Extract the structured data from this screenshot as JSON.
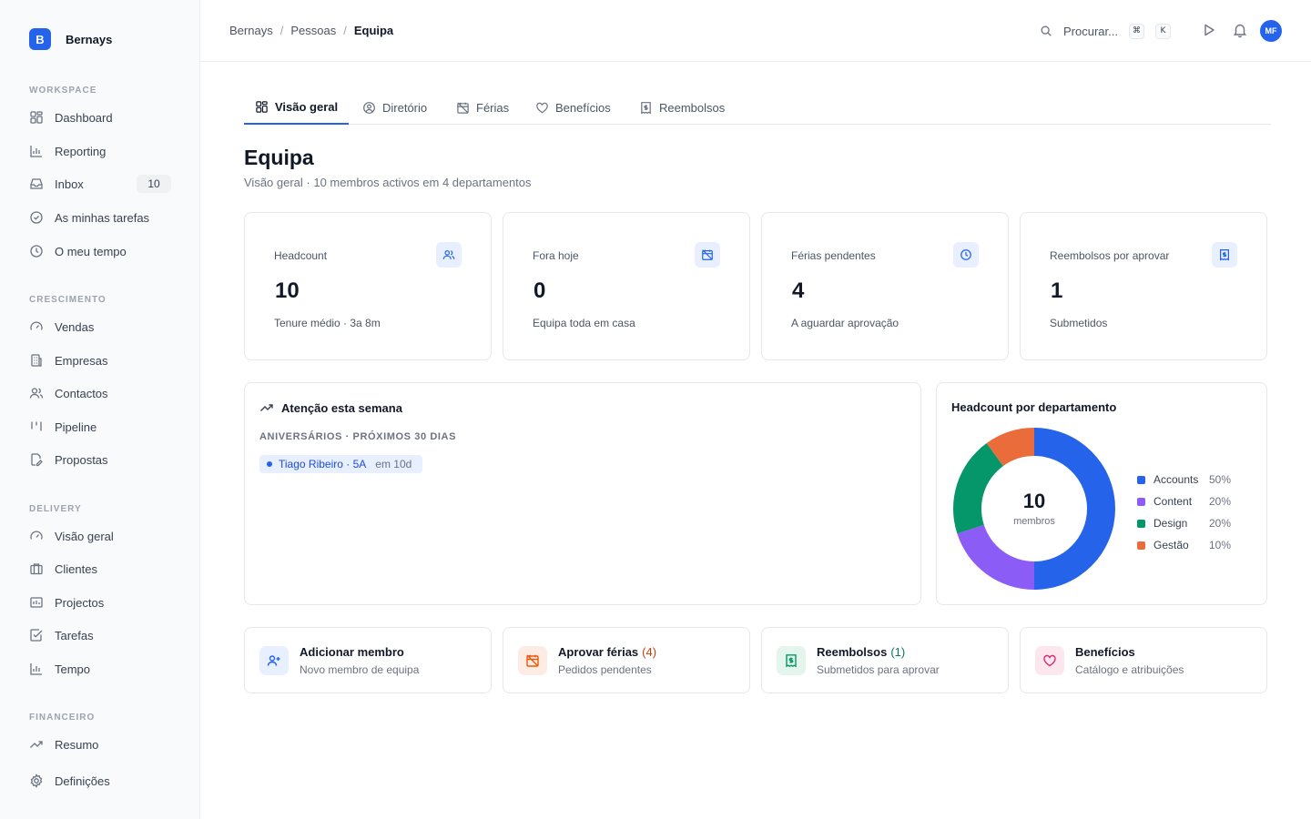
{
  "brand": {
    "initial": "B",
    "name": "Bernays"
  },
  "sidebar": {
    "sections": [
      {
        "label": "WORKSPACE",
        "items": [
          {
            "label": "Dashboard",
            "icon": "grid-icon"
          },
          {
            "label": "Reporting",
            "icon": "bar-chart-icon"
          },
          {
            "label": "Inbox",
            "icon": "inbox-icon",
            "badge": "10"
          },
          {
            "label": "As minhas tarefas",
            "icon": "check-circle-icon"
          },
          {
            "label": "O meu tempo",
            "icon": "clock-icon"
          }
        ]
      },
      {
        "label": "CRESCIMENTO",
        "items": [
          {
            "label": "Vendas",
            "icon": "gauge-icon"
          },
          {
            "label": "Empresas",
            "icon": "building-icon"
          },
          {
            "label": "Contactos",
            "icon": "users-icon"
          },
          {
            "label": "Pipeline",
            "icon": "pipeline-icon"
          },
          {
            "label": "Propostas",
            "icon": "document-edit-icon"
          }
        ]
      },
      {
        "label": "DELIVERY",
        "items": [
          {
            "label": "Visão geral",
            "icon": "gauge-icon"
          },
          {
            "label": "Clientes",
            "icon": "briefcase-icon"
          },
          {
            "label": "Projectos",
            "icon": "folder-icon"
          },
          {
            "label": "Tarefas",
            "icon": "checkbox-icon"
          },
          {
            "label": "Tempo",
            "icon": "bar-chart-icon"
          }
        ]
      },
      {
        "label": "FINANCEIRO",
        "items": [
          {
            "label": "Resumo",
            "icon": "trend-icon"
          },
          {
            "label": "Definições",
            "icon": "gear-icon"
          }
        ]
      }
    ]
  },
  "header": {
    "breadcrumb": [
      "Bernays",
      "Pessoas",
      "Equipa"
    ],
    "search_label": "Procurar...",
    "shortcut": [
      "⌘",
      "K"
    ],
    "avatar_initials": "MF"
  },
  "tabs": [
    {
      "label": "Visão geral",
      "icon": "grid-icon",
      "active": true
    },
    {
      "label": "Diretório",
      "icon": "user-circle-icon"
    },
    {
      "label": "Férias",
      "icon": "calendar-off-icon"
    },
    {
      "label": "Benefícios",
      "icon": "heart-icon"
    },
    {
      "label": "Reembolsos",
      "icon": "receipt-icon"
    }
  ],
  "page": {
    "title": "Equipa",
    "subtitle": "Visão geral · 10 membros activos em 4 departamentos"
  },
  "stats": [
    {
      "label": "Headcount",
      "value": "10",
      "desc": "Tenure médio · 3a 8m",
      "icon": "users-icon"
    },
    {
      "label": "Fora hoje",
      "value": "0",
      "desc": "Equipa toda em casa",
      "icon": "calendar-off-icon"
    },
    {
      "label": "Férias pendentes",
      "value": "4",
      "desc": "A aguardar aprovação",
      "icon": "clock-icon"
    },
    {
      "label": "Reembolsos por aprovar",
      "value": "1",
      "desc": "Submetidos",
      "icon": "receipt-icon"
    }
  ],
  "attention": {
    "title": "Atenção esta semana",
    "section": "ANIVERSÁRIOS · PRÓXIMOS 30 DIAS",
    "chip": {
      "text": "Tiago Ribeiro · 5A",
      "when": "em 10d"
    }
  },
  "department_panel": {
    "title": "Headcount por departamento",
    "center_value": "10",
    "center_label": "membros"
  },
  "chart_data": {
    "type": "pie",
    "title": "Headcount por departamento",
    "categories": [
      "Accounts",
      "Content",
      "Design",
      "Gestão"
    ],
    "values": [
      50,
      20,
      20,
      10
    ],
    "labels": [
      "50%",
      "20%",
      "20%",
      "10%"
    ],
    "colors": [
      "#2563eb",
      "#8b5cf6",
      "#059669",
      "#ea6c3a"
    ],
    "legend": "right"
  },
  "actions": [
    {
      "title": "Adicionar membro",
      "count": "",
      "sub": "Novo membro de equipa",
      "icon": "user-plus-icon",
      "bg": "#e8efff",
      "fg": "#2563eb",
      "count_color": "#111827"
    },
    {
      "title": "Aprovar férias",
      "count": "(4)",
      "sub": "Pedidos pendentes",
      "icon": "calendar-off-icon",
      "bg": "#fdece4",
      "fg": "#ea580c",
      "count_color": "#c2410c"
    },
    {
      "title": "Reembolsos",
      "count": "(1)",
      "sub": "Submetidos para aprovar",
      "icon": "receipt-icon",
      "bg": "#e3f5ec",
      "fg": "#059669",
      "count_color": "#047857"
    },
    {
      "title": "Benefícios",
      "count": "",
      "sub": "Catálogo e atribuições",
      "icon": "heart-icon",
      "bg": "#fde7ef",
      "fg": "#db2777",
      "count_color": "#111827"
    }
  ]
}
